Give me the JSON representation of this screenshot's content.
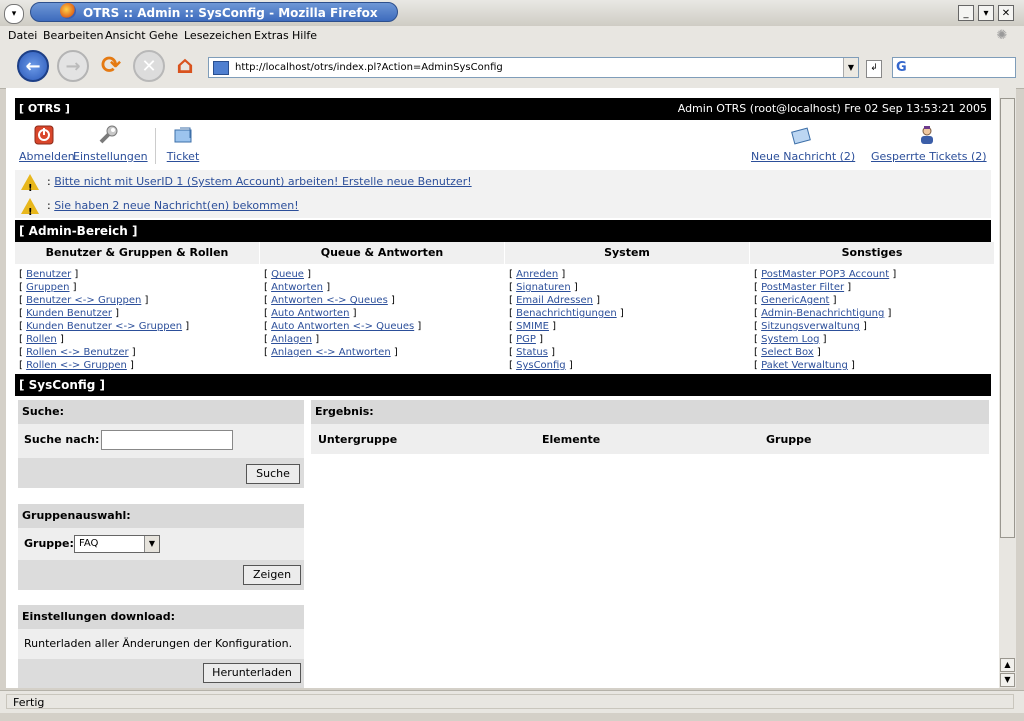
{
  "window": {
    "title": "OTRS :: Admin :: SysConfig - Mozilla Firefox"
  },
  "menubar": [
    "Datei",
    "Bearbeiten",
    "Ansicht",
    "Gehe",
    "Lesezeichen",
    "Extras",
    "Hilfe"
  ],
  "navbar": {
    "url": "http://localhost/otrs/index.pl?Action=AdminSysConfig",
    "search_placeholder": ""
  },
  "otrs": {
    "brand": "[ OTRS ]",
    "user_info": "Admin OTRS (root@localhost) Fre 02 Sep 13:53:21 2005",
    "toolbar": {
      "logout": "Abmelden",
      "prefs": "Einstellungen",
      "ticket": "Ticket",
      "new_messages": "Neue Nachricht (2)",
      "locked_tickets": "Gesperrte Tickets (2)"
    },
    "notices": [
      "Bitte nicht mit UserID 1 (System Account) arbeiten! Erstelle neue Benutzer!",
      "Sie haben 2 neue Nachricht(en) bekommen!"
    ],
    "admin_title": "[ Admin-Bereich ]",
    "admin_columns": [
      {
        "title": "Benutzer & Gruppen & Rollen",
        "links": [
          "Benutzer",
          "Gruppen",
          "Benutzer <-> Gruppen",
          "Kunden Benutzer",
          "Kunden Benutzer <-> Gruppen",
          "Rollen",
          "Rollen <-> Benutzer",
          "Rollen <-> Gruppen"
        ]
      },
      {
        "title": "Queue & Antworten",
        "links": [
          "Queue",
          "Antworten",
          "Antworten <-> Queues",
          "Auto Antworten",
          "Auto Antworten <-> Queues",
          "Anlagen",
          "Anlagen <-> Antworten"
        ]
      },
      {
        "title": "System",
        "links": [
          "Anreden",
          "Signaturen",
          "Email Adressen",
          "Benachrichtigungen",
          "SMIME",
          "PGP",
          "Status",
          "SysConfig"
        ]
      },
      {
        "title": "Sonstiges",
        "links": [
          "PostMaster POP3 Account",
          "PostMaster Filter",
          "GenericAgent",
          "Admin-Benachrichtigung",
          "Sitzungsverwaltung",
          "System Log",
          "Select Box",
          "Paket Verwaltung"
        ]
      }
    ],
    "sysconfig_title": "[ SysConfig ]",
    "search": {
      "head": "Suche:",
      "label": "Suche nach:",
      "value": "",
      "button": "Suche"
    },
    "group": {
      "head": "Gruppenauswahl:",
      "label": "Gruppe:",
      "selected": "FAQ",
      "button": "Zeigen"
    },
    "download": {
      "head": "Einstellungen download:",
      "text": "Runterladen aller Änderungen der Konfiguration.",
      "button": "Herunterladen"
    },
    "result": {
      "head": "Ergebnis:",
      "columns": [
        "Untergruppe",
        "Elemente",
        "Gruppe"
      ]
    }
  },
  "status": "Fertig"
}
